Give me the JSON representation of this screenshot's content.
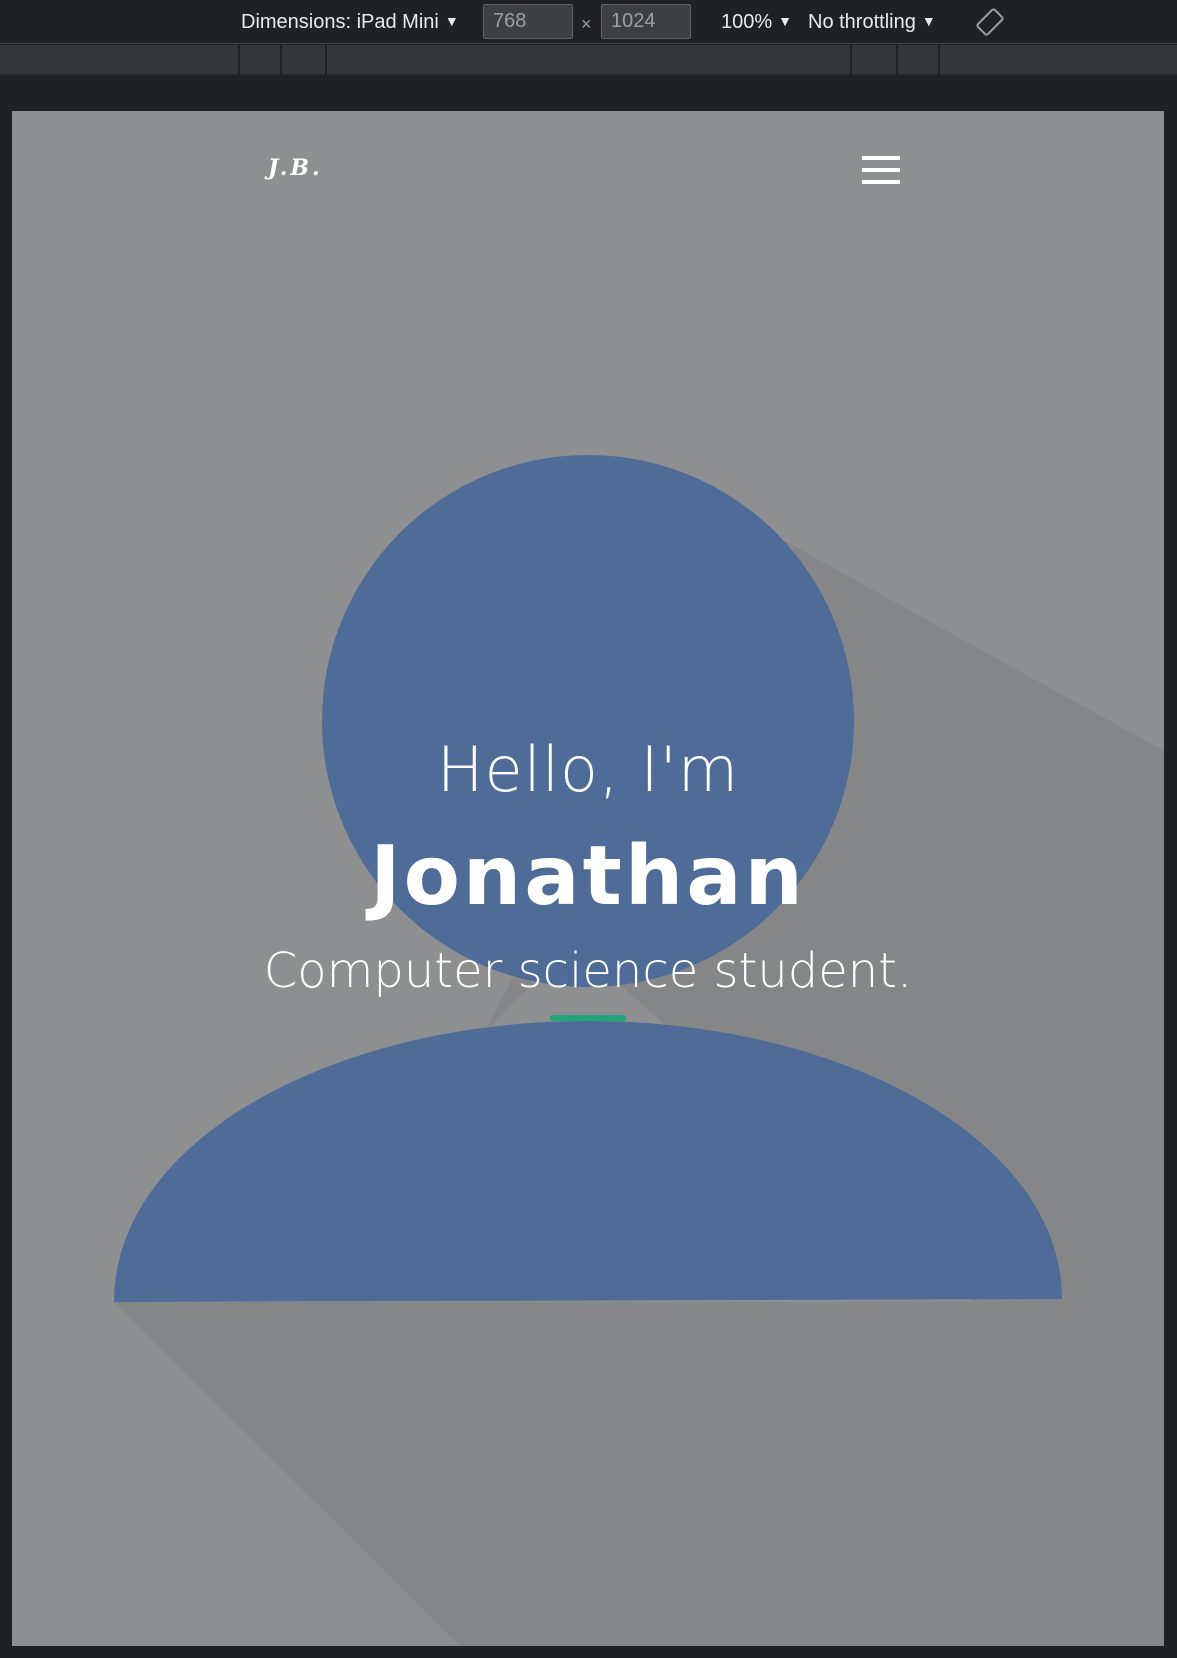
{
  "devtools": {
    "device_label": "Dimensions: iPad Mini",
    "width_value": "768",
    "height_value": "1024",
    "times_symbol": "×",
    "zoom_label": "100%",
    "throttling_label": "No throttling",
    "dropdown_arrow": "▼",
    "rotate_icon": "rotate-icon"
  },
  "page": {
    "logo_text": "J.B.",
    "menu_icon": "hamburger-menu-icon",
    "greeting": "Hello, I'm",
    "name": "Jonathan",
    "tagline": "Computer science student.",
    "colors": {
      "background": "#8e8f91",
      "avatar": "#4f6b97",
      "shadow": "#858688",
      "accent": "#1fa67a",
      "text": "#ffffff"
    }
  }
}
